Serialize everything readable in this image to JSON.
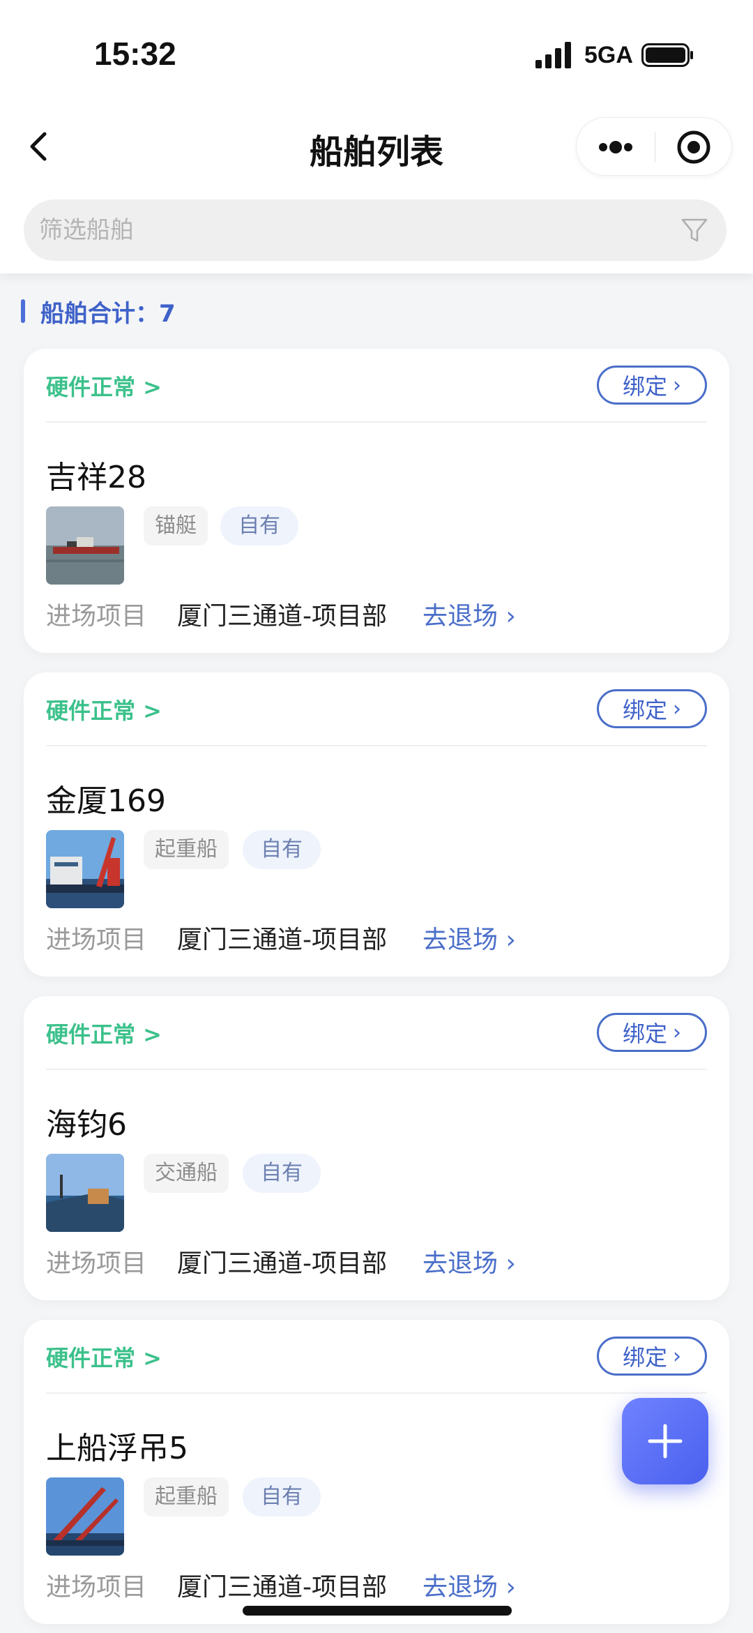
{
  "status_bar": {
    "time": "15:32",
    "network": "5GA",
    "icons": [
      "signal-icon",
      "battery-icon"
    ]
  },
  "nav": {
    "title": "船舶列表",
    "back_icon": "back-chevron-icon",
    "more_icon": "more-dots-icon",
    "close_icon": "target-circle-icon"
  },
  "search": {
    "placeholder": "筛选船舶",
    "value": "",
    "icon": "filter-funnel-icon"
  },
  "summary": {
    "text": "船舶合计：7"
  },
  "ships": [
    {
      "hardware_status": "硬件正常 >",
      "bind_label": "绑定",
      "name": "吉祥28",
      "type_tag": "锚艇",
      "ownership_tag": "自有",
      "entry_label": "进场项目",
      "project": "厦门三通道-项目部",
      "exit_link": "去退场 ›"
    },
    {
      "hardware_status": "硬件正常 >",
      "bind_label": "绑定",
      "name": "金厦169",
      "type_tag": "起重船",
      "ownership_tag": "自有",
      "entry_label": "进场项目",
      "project": "厦门三通道-项目部",
      "exit_link": "去退场 ›"
    },
    {
      "hardware_status": "硬件正常 >",
      "bind_label": "绑定",
      "name": "海钧6",
      "type_tag": "交通船",
      "ownership_tag": "自有",
      "entry_label": "进场项目",
      "project": "厦门三通道-项目部",
      "exit_link": "去退场 ›"
    },
    {
      "hardware_status": "硬件正常 >",
      "bind_label": "绑定",
      "name": "上船浮吊5",
      "type_tag": "起重船",
      "ownership_tag": "自有",
      "entry_label": "进场项目",
      "project": "厦门三通道-项目部",
      "exit_link": "去退场 ›"
    }
  ],
  "fab": {
    "icon": "plus-icon"
  },
  "colors": {
    "accent_blue": "#4a6ec9",
    "status_green": "#3cc18b",
    "fab_blue": "#4a60ee",
    "page_background": "#f4f5f7"
  }
}
